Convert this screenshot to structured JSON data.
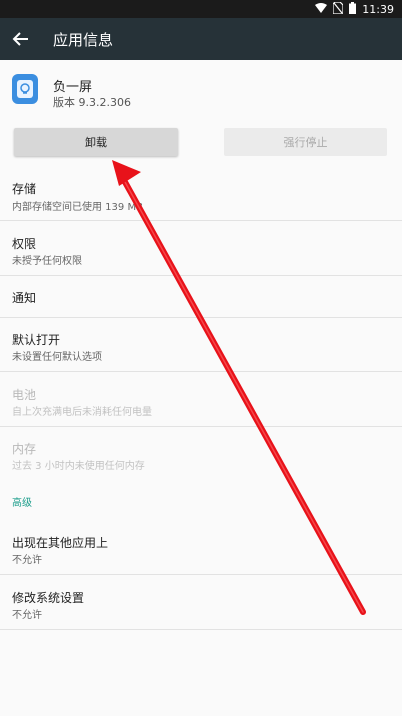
{
  "status": {
    "time": "11:39"
  },
  "appbar": {
    "title": "应用信息"
  },
  "app": {
    "name": "负一屏",
    "version": "版本 9.3.2.306"
  },
  "buttons": {
    "uninstall": "卸载",
    "force_stop": "强行停止"
  },
  "rows": [
    {
      "title": "存储",
      "subtitle": "内部存储空间已使用 139 MB",
      "enabled": true
    },
    {
      "title": "权限",
      "subtitle": "未授予任何权限",
      "enabled": true
    },
    {
      "title": "通知",
      "subtitle": "",
      "enabled": true
    },
    {
      "title": "默认打开",
      "subtitle": "未设置任何默认选项",
      "enabled": true
    },
    {
      "title": "电池",
      "subtitle": "自上次充满电后未消耗任何电量",
      "enabled": false
    },
    {
      "title": "内存",
      "subtitle": "过去 3 小时内未使用任何内存",
      "enabled": false
    }
  ],
  "advanced": {
    "header": "高级",
    "rows": [
      {
        "title": "出现在其他应用上",
        "subtitle": "不允许"
      },
      {
        "title": "修改系统设置",
        "subtitle": "不允许"
      }
    ]
  },
  "colors": {
    "appbar": "#263238",
    "accent": "#1e9e8c",
    "annotation_arrow": "#e8121a"
  }
}
